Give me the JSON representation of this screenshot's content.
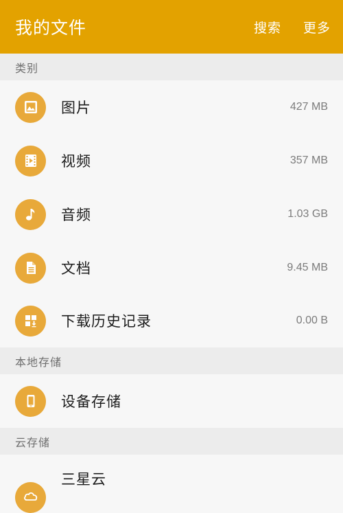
{
  "header": {
    "title": "我的文件",
    "search_label": "搜索",
    "more_label": "更多"
  },
  "sections": {
    "categories_label": "类别",
    "local_storage_label": "本地存储",
    "cloud_storage_label": "云存储"
  },
  "categories": [
    {
      "label": "图片",
      "size": "427 MB",
      "icon": "image-icon"
    },
    {
      "label": "视频",
      "size": "357 MB",
      "icon": "video-icon"
    },
    {
      "label": "音频",
      "size": "1.03 GB",
      "icon": "music-note-icon"
    },
    {
      "label": "文档",
      "size": "9.45 MB",
      "icon": "document-icon"
    },
    {
      "label": "下载历史记录",
      "size": "0.00 B",
      "icon": "download-history-icon"
    }
  ],
  "local_storage": [
    {
      "label": "设备存储",
      "icon": "phone-icon"
    }
  ],
  "cloud_storage": [
    {
      "label": "三星云",
      "icon": "cloud-icon"
    }
  ],
  "colors": {
    "accent": "#e3a200",
    "icon_circle": "#e8a93a",
    "section_bg": "#ececec",
    "row_bg": "#f7f7f7"
  }
}
